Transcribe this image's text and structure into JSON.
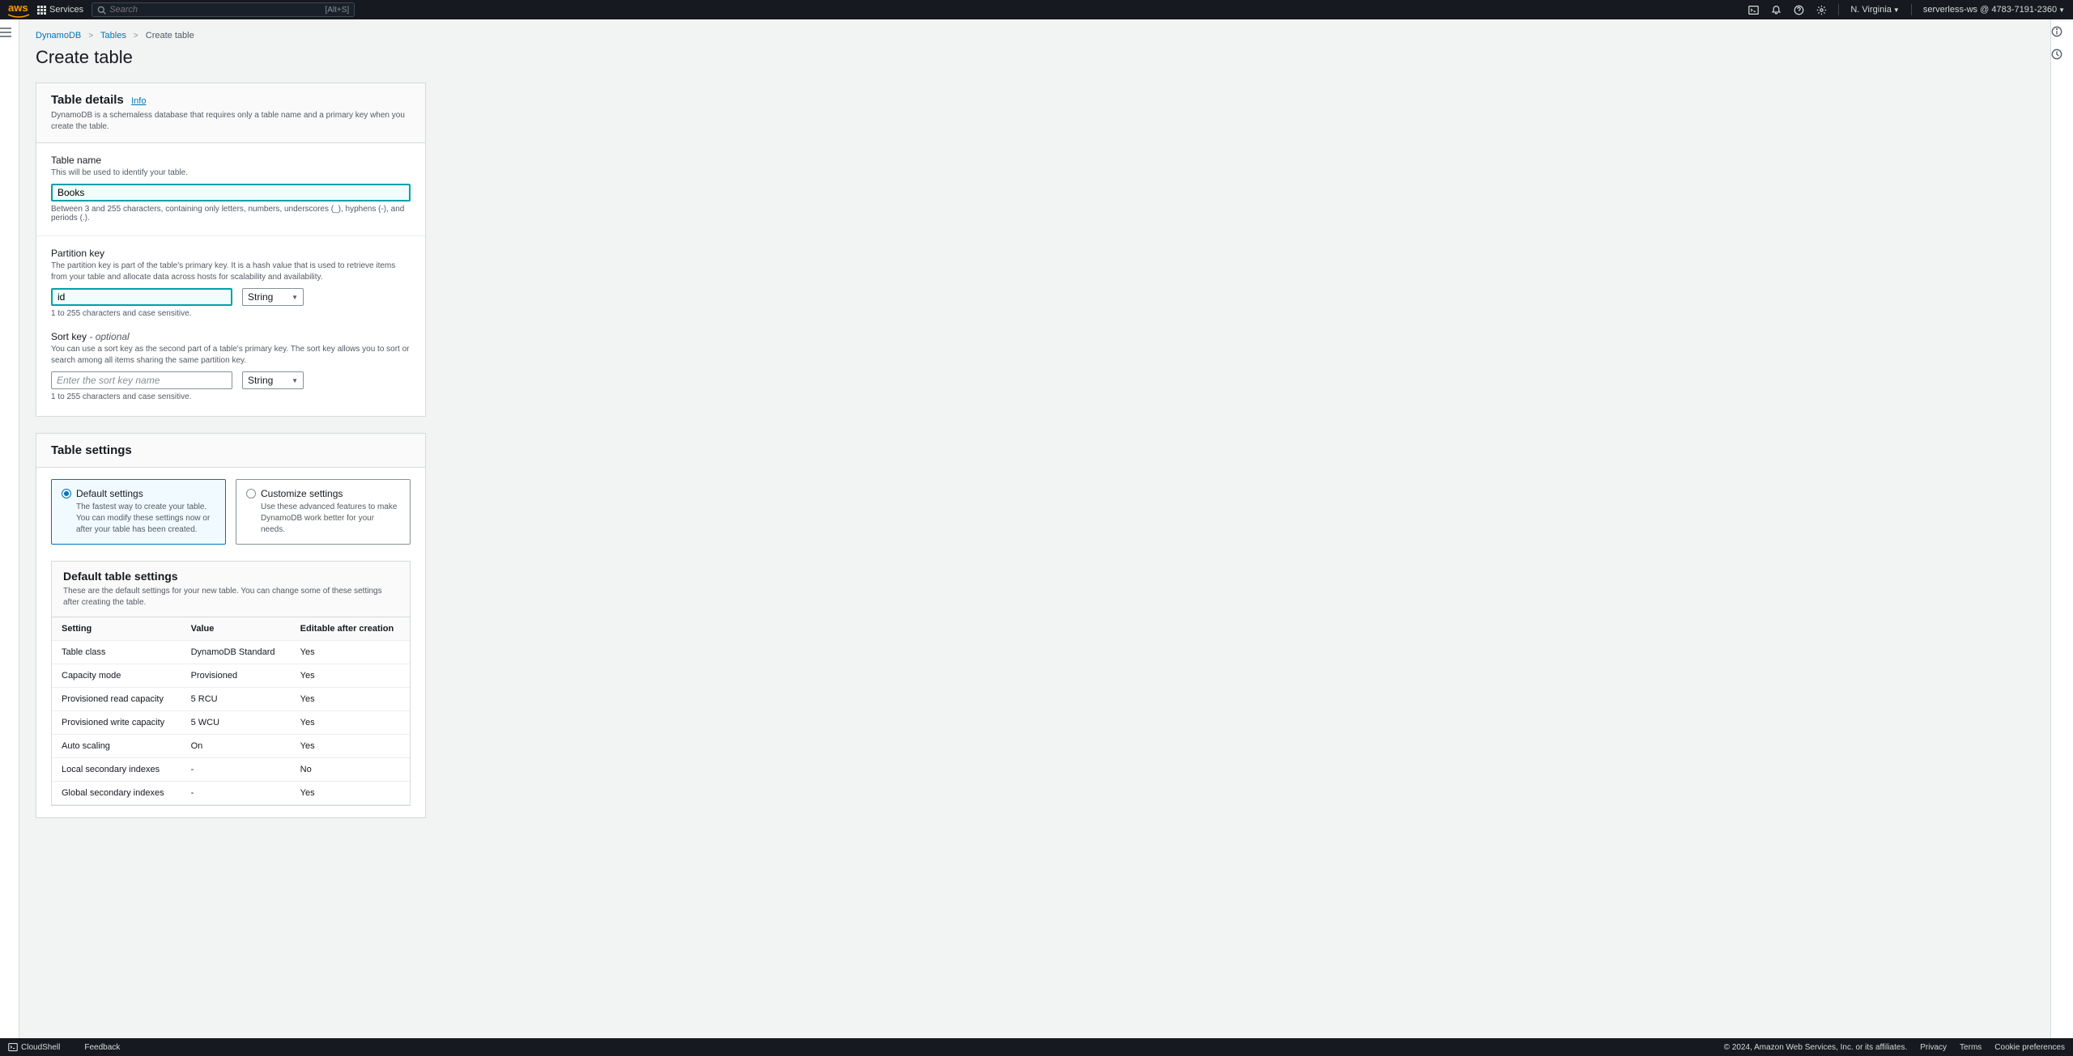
{
  "nav": {
    "logo": "aws",
    "services": "Services",
    "search_placeholder": "Search",
    "search_shortcut": "[Alt+S]",
    "region": "N. Virginia",
    "account": "serverless-ws @ 4783-7191-2360"
  },
  "breadcrumb": {
    "items": [
      "DynamoDB",
      "Tables",
      "Create table"
    ]
  },
  "page_title": "Create table",
  "details": {
    "heading": "Table details",
    "info": "Info",
    "desc": "DynamoDB is a schemaless database that requires only a table name and a primary key when you create the table.",
    "table_name": {
      "label": "Table name",
      "hint": "This will be used to identify your table.",
      "value": "Books",
      "constraint": "Between 3 and 255 characters, containing only letters, numbers, underscores (_), hyphens (-), and periods (.)."
    },
    "partition_key": {
      "label": "Partition key",
      "hint": "The partition key is part of the table's primary key. It is a hash value that is used to retrieve items from your table and allocate data across hosts for scalability and availability.",
      "value": "id",
      "type": "String",
      "constraint": "1 to 255 characters and case sensitive."
    },
    "sort_key": {
      "label": "Sort key",
      "optional": "- optional",
      "hint": "You can use a sort key as the second part of a table's primary key. The sort key allows you to sort or search among all items sharing the same partition key.",
      "placeholder": "Enter the sort key name",
      "type": "String",
      "constraint": "1 to 255 characters and case sensitive."
    }
  },
  "settings_panel": {
    "heading": "Table settings",
    "tiles": [
      {
        "title": "Default settings",
        "desc": "The fastest way to create your table. You can modify these settings now or after your table has been created.",
        "selected": true
      },
      {
        "title": "Customize settings",
        "desc": "Use these advanced features to make DynamoDB work better for your needs.",
        "selected": false
      }
    ],
    "defaults": {
      "heading": "Default table settings",
      "desc": "These are the default settings for your new table. You can change some of these settings after creating the table.",
      "columns": [
        "Setting",
        "Value",
        "Editable after creation"
      ],
      "rows": [
        {
          "setting": "Table class",
          "value": "DynamoDB Standard",
          "editable": "Yes"
        },
        {
          "setting": "Capacity mode",
          "value": "Provisioned",
          "editable": "Yes"
        },
        {
          "setting": "Provisioned read capacity",
          "value": "5 RCU",
          "editable": "Yes"
        },
        {
          "setting": "Provisioned write capacity",
          "value": "5 WCU",
          "editable": "Yes"
        },
        {
          "setting": "Auto scaling",
          "value": "On",
          "editable": "Yes"
        },
        {
          "setting": "Local secondary indexes",
          "value": "-",
          "editable": "No"
        },
        {
          "setting": "Global secondary indexes",
          "value": "-",
          "editable": "Yes"
        }
      ]
    }
  },
  "footer": {
    "cloudshell": "CloudShell",
    "feedback": "Feedback",
    "copyright": "© 2024, Amazon Web Services, Inc. or its affiliates.",
    "links": [
      "Privacy",
      "Terms",
      "Cookie preferences"
    ]
  }
}
